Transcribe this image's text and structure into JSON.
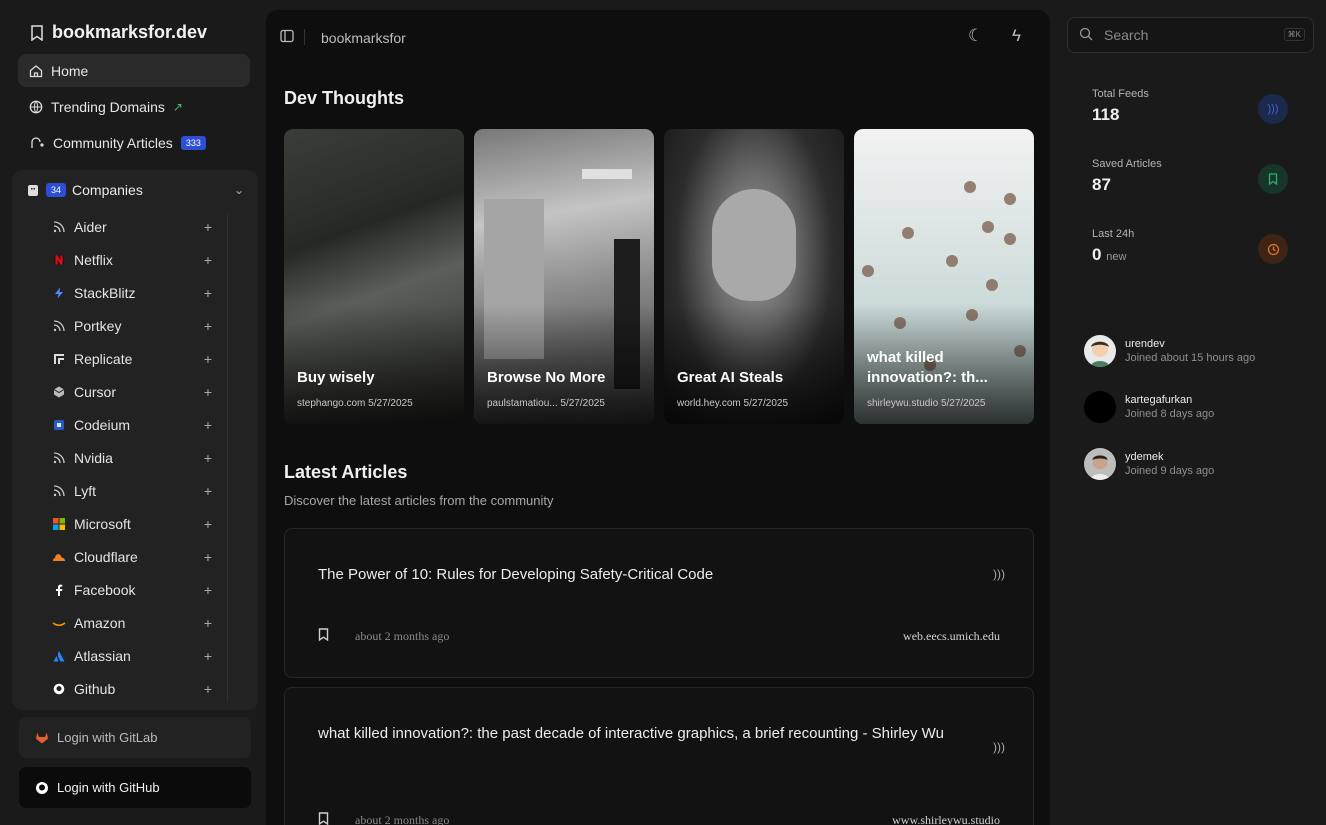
{
  "brand": {
    "title": "bookmarksfor.dev"
  },
  "nav": {
    "home": "Home",
    "trending": "Trending Domains",
    "community": "Community Articles",
    "community_count": "333"
  },
  "companies": {
    "label": "Companies",
    "count": "34",
    "items": [
      {
        "name": "Aider",
        "icon": "rss-icon"
      },
      {
        "name": "Netflix",
        "icon": "netflix-icon"
      },
      {
        "name": "StackBlitz",
        "icon": "stackblitz-icon"
      },
      {
        "name": "Portkey",
        "icon": "rss-icon"
      },
      {
        "name": "Replicate",
        "icon": "replicate-icon"
      },
      {
        "name": "Cursor",
        "icon": "cursor-icon"
      },
      {
        "name": "Codeium",
        "icon": "codeium-icon"
      },
      {
        "name": "Nvidia",
        "icon": "rss-icon"
      },
      {
        "name": "Lyft",
        "icon": "rss-icon"
      },
      {
        "name": "Microsoft",
        "icon": "microsoft-icon"
      },
      {
        "name": "Cloudflare",
        "icon": "cloudflare-icon"
      },
      {
        "name": "Facebook",
        "icon": "facebook-icon"
      },
      {
        "name": "Amazon",
        "icon": "amazon-icon"
      },
      {
        "name": "Atlassian",
        "icon": "atlassian-icon"
      },
      {
        "name": "Github",
        "icon": "github-icon"
      }
    ]
  },
  "auth": {
    "gitlab": "Login with GitLab",
    "github": "Login with GitHub"
  },
  "topbar": {
    "breadcrumb": "bookmarksfor"
  },
  "dev_thoughts": {
    "title": "Dev Thoughts",
    "cards": [
      {
        "title": "Buy wisely",
        "source": "stephango.com",
        "date": "5/27/2025"
      },
      {
        "title": "Browse No More",
        "source": "paulstamatiou...",
        "date": "5/27/2025"
      },
      {
        "title": "Great AI Steals",
        "source": "world.hey.com",
        "date": "5/27/2025"
      },
      {
        "title": "what killed innovation?: th...",
        "source": "shirleywu.studio",
        "date": "5/27/2025"
      }
    ]
  },
  "latest": {
    "title": "Latest Articles",
    "subtitle": "Discover the latest articles from the community",
    "articles": [
      {
        "title": "The Power of 10: Rules for Developing Safety-Critical Code",
        "ago": "about 2 months ago",
        "domain": "web.eecs.umich.edu"
      },
      {
        "title": "what killed innovation?: the past decade of interactive graphics, a brief recounting - Shirley Wu",
        "ago": "about 2 months ago",
        "domain": "www.shirleywu.studio"
      }
    ]
  },
  "search": {
    "placeholder": "Search",
    "shortcut": "⌘K"
  },
  "stats": {
    "total_feeds_label": "Total Feeds",
    "total_feeds": "118",
    "saved_label": "Saved Articles",
    "saved": "87",
    "last24_label": "Last 24h",
    "last24": "0",
    "last24_unit": "new"
  },
  "users": [
    {
      "name": "urendev",
      "joined": "Joined about 15 hours ago"
    },
    {
      "name": "kartegafurkan",
      "joined": "Joined 8 days ago"
    },
    {
      "name": "ydemek",
      "joined": "Joined 9 days ago"
    }
  ],
  "colors": {
    "accent": "#2d4fd6",
    "feeds": "#3a63d9",
    "saved": "#2fae6a",
    "last24": "#e0741f"
  }
}
